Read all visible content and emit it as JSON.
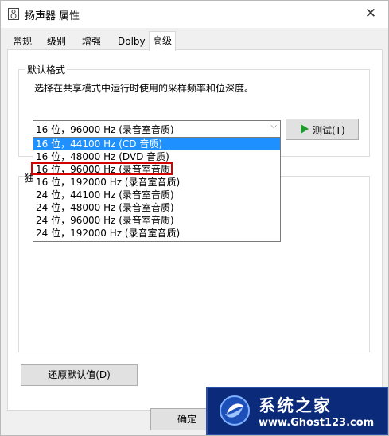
{
  "window": {
    "title": "扬声器 属性",
    "close_symbol": "✕"
  },
  "tabs": [
    {
      "label": "常规"
    },
    {
      "label": "级别"
    },
    {
      "label": "增强"
    },
    {
      "label": "Dolby"
    },
    {
      "label": "高级",
      "active": true
    }
  ],
  "default_format": {
    "group_title": "默认格式",
    "description": "选择在共享模式中运行时使用的采样频率和位深度。",
    "selected_value": "16 位，96000 Hz (录音室音质)",
    "test_button": "测试(T)",
    "options": [
      "16 位，44100 Hz (CD 音质)",
      "16 位，48000 Hz (DVD 音质)",
      "16 位，96000 Hz (录音室音质)",
      "16 位，192000 Hz (录音室音质)",
      "24 位，44100 Hz (录音室音质)",
      "24 位，48000 Hz (录音室音质)",
      "24 位，96000 Hz (录音室音质)",
      "24 位，192000 Hz (录音室音质)"
    ],
    "highlighted_option_index": 0,
    "marked_option_index": 2
  },
  "exclusive_group": {
    "partial_title": "独"
  },
  "buttons": {
    "restore": "还原默认值(D)",
    "ok": "确定"
  },
  "watermark": {
    "title": "系统之家",
    "url": "www.Ghost123.com"
  },
  "colors": {
    "highlight": "#1e90ff",
    "annotation_box": "#d40000",
    "play_icon": "#1e9a2b",
    "watermark_bg": "#0c2a7a"
  }
}
